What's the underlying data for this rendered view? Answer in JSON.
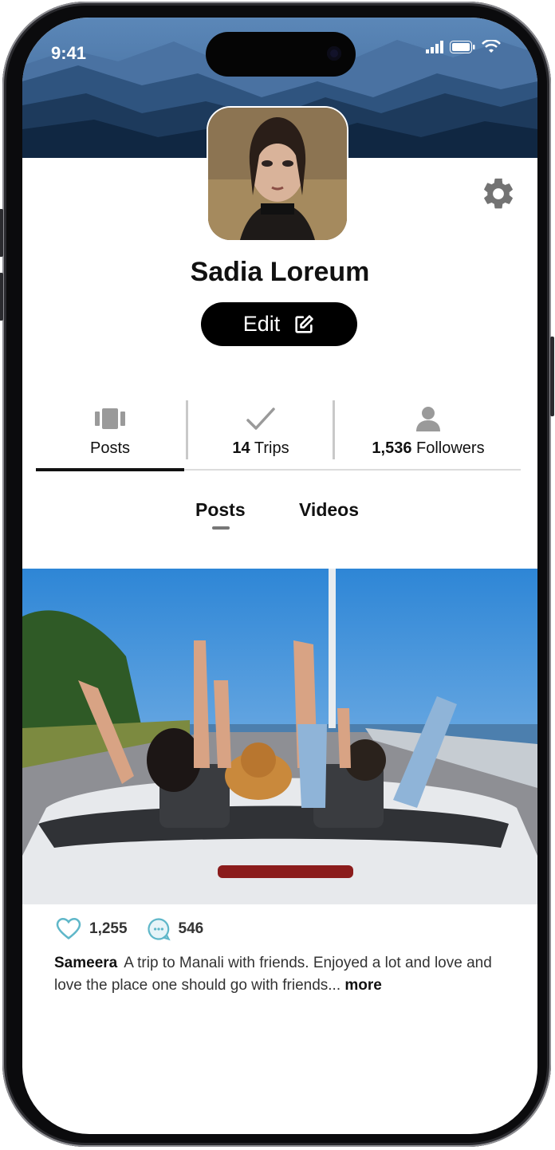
{
  "status_bar": {
    "time": "9:41"
  },
  "profile": {
    "name": "Sadia Loreum",
    "edit_label": "Edit"
  },
  "stats": {
    "posts_label": "Posts",
    "trips_count": "14",
    "trips_label": "Trips",
    "followers_count": "1,536",
    "followers_label": "Followers"
  },
  "tabs": {
    "posts": "Posts",
    "videos": "Videos"
  },
  "post": {
    "likes": "1,255",
    "comments": "546",
    "author": "Sameera",
    "caption": "A trip to Manali with friends. Enjoyed a lot and love and love the place one should go with friends... ",
    "more": "more"
  },
  "icons": {
    "settings": "gear-icon",
    "edit": "edit-icon",
    "posts": "gallery-icon",
    "trips": "check-icon",
    "followers": "person-icon",
    "likes": "heart-icon",
    "comments": "comment-icon"
  },
  "colors": {
    "accent": "#000000",
    "icon_gray": "#9a9a9a",
    "like_blue": "#5fb7c9"
  }
}
